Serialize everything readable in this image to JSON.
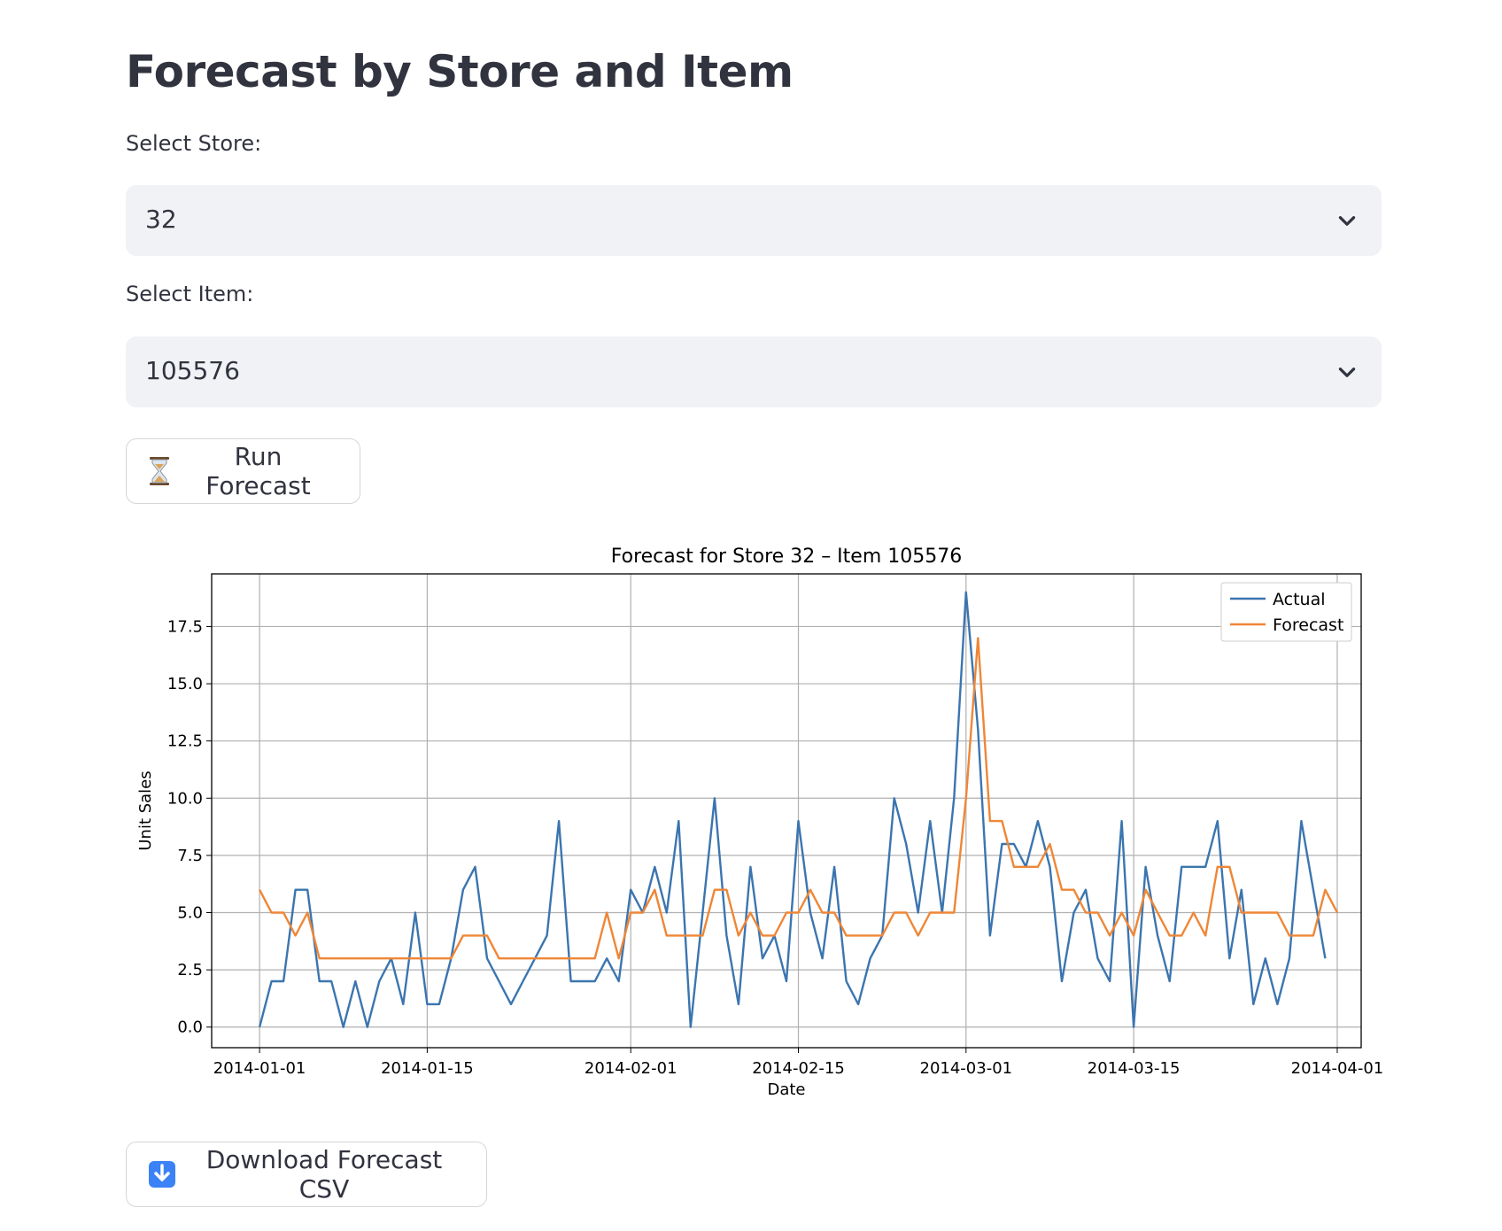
{
  "page": {
    "title": "Forecast by Store and Item"
  },
  "store_select": {
    "label": "Select Store:",
    "value": "32"
  },
  "item_select": {
    "label": "Select Item:",
    "value": "105576"
  },
  "run_button": {
    "label": "Run Forecast",
    "icon": "hourglass-icon"
  },
  "download_button": {
    "label": "Download Forecast CSV",
    "icon": "down-arrow-icon"
  },
  "colors": {
    "actual": "#3b75af",
    "forecast": "#ef8636",
    "button_icon_blue": "#3b82f6",
    "select_bg": "#f0f2f6",
    "text": "#31333f"
  },
  "chart_data": {
    "type": "line",
    "title": "Forecast for Store 32 – Item 105576",
    "xlabel": "Date",
    "ylabel": "Unit Sales",
    "x_start": "2014-01-01",
    "x_end": "2014-03-30",
    "xlim": [
      "2013-12-28",
      "2014-04-03"
    ],
    "ylim": [
      -0.9,
      19.8
    ],
    "x_ticks": [
      "2014-01-01",
      "2014-01-15",
      "2014-02-01",
      "2014-02-15",
      "2014-03-01",
      "2014-03-15",
      "2014-04-01"
    ],
    "y_ticks": [
      "0.0",
      "2.5",
      "5.0",
      "7.5",
      "10.0",
      "12.5",
      "15.0",
      "17.5"
    ],
    "grid": true,
    "legend_position": "top-right",
    "series": [
      {
        "name": "Actual",
        "values": [
          0,
          2,
          2,
          6,
          6,
          2,
          2,
          0,
          2,
          0,
          2,
          3,
          1,
          5,
          1,
          1,
          3,
          6,
          7,
          3,
          2,
          1,
          2,
          3,
          4,
          9,
          2,
          2,
          2,
          3,
          2,
          6,
          5,
          7,
          5,
          9,
          0,
          5,
          10,
          4,
          1,
          7,
          3,
          4,
          2,
          9,
          5,
          3,
          7,
          2,
          1,
          3,
          4,
          10,
          8,
          5,
          9,
          5,
          10,
          19,
          13,
          4,
          8,
          8,
          7,
          9,
          7,
          2,
          5,
          6,
          3,
          2,
          9,
          0,
          7,
          4,
          2,
          7,
          7,
          7,
          9,
          3,
          6,
          1,
          3,
          1,
          3,
          9,
          6,
          3
        ]
      },
      {
        "name": "Forecast",
        "values": [
          6,
          5,
          5,
          4,
          5,
          3,
          3,
          3,
          3,
          3,
          3,
          3,
          3,
          3,
          3,
          3,
          3,
          4,
          4,
          4,
          3,
          3,
          3,
          3,
          3,
          3,
          3,
          3,
          3,
          5,
          3,
          5,
          5,
          6,
          4,
          4,
          4,
          4,
          6,
          6,
          4,
          5,
          4,
          4,
          5,
          5,
          6,
          5,
          5,
          4,
          4,
          4,
          4,
          5,
          5,
          4,
          5,
          5,
          5,
          10,
          17,
          9,
          9,
          7,
          7,
          7,
          8,
          6,
          6,
          5,
          5,
          4,
          5,
          4,
          6,
          5,
          4,
          4,
          5,
          4,
          7,
          7,
          5,
          5,
          5,
          5,
          4,
          4,
          4,
          6,
          5
        ]
      }
    ]
  }
}
